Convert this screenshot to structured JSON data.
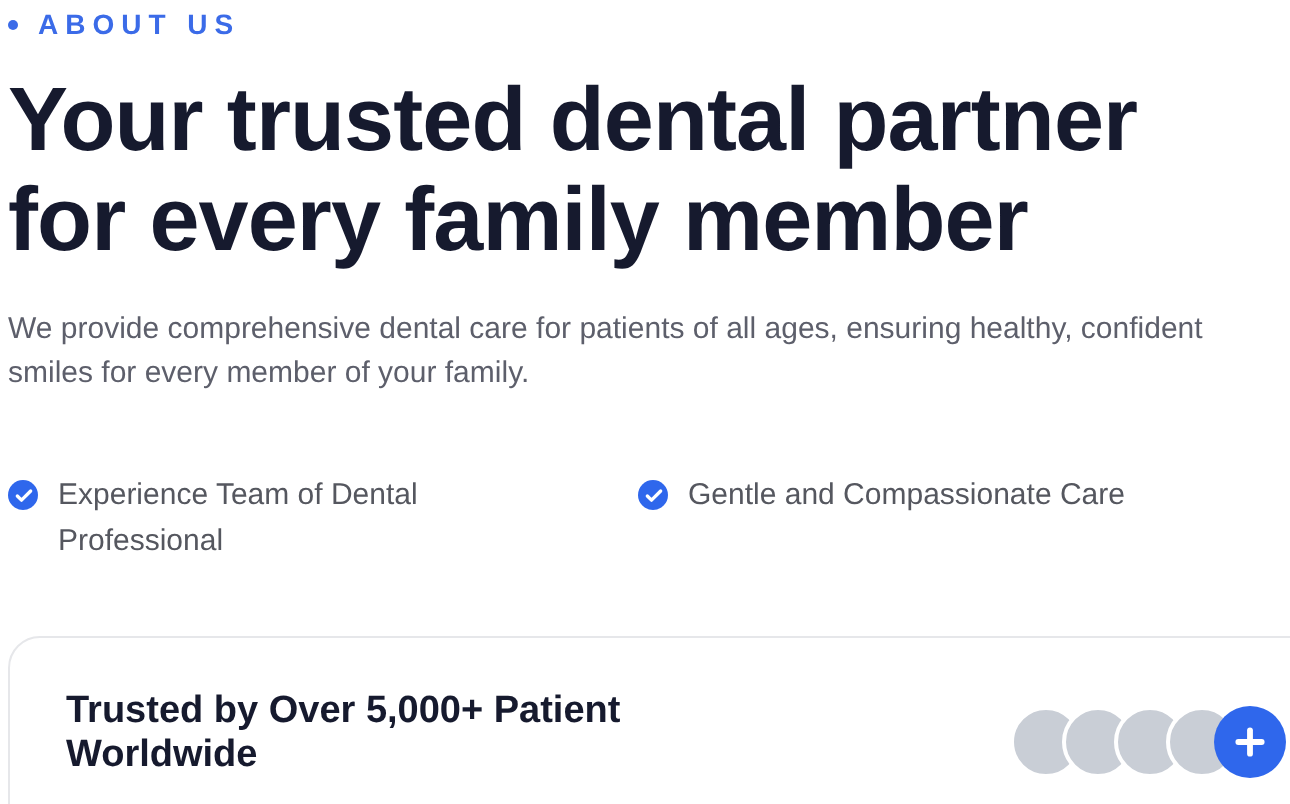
{
  "eyebrow": "ABOUT US",
  "heading": "Your trusted dental partner for every family member",
  "description": "We provide comprehensive dental care for patients of all ages, ensuring healthy, confident smiles for every member of your family.",
  "features": [
    {
      "label": "Experience Team of Dental Professional"
    },
    {
      "label": "Gentle and Compassionate Care"
    }
  ],
  "trust_card": {
    "title": "Trusted by Over 5,000+ Patient Worldwide"
  }
}
